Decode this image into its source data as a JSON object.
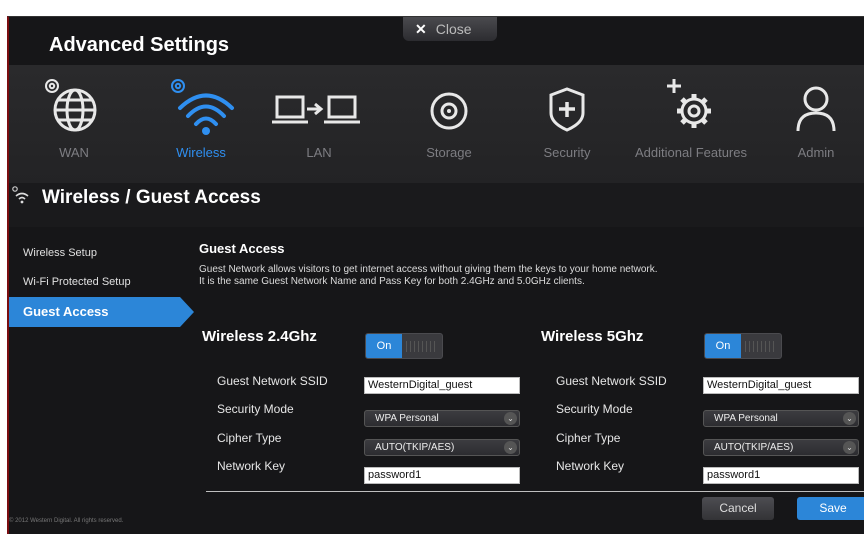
{
  "window": {
    "title": "Advanced Settings",
    "close_label": "Close"
  },
  "nav": {
    "items": [
      {
        "label": "WAN",
        "icon": "globe-gear-icon",
        "active": false
      },
      {
        "label": "Wireless",
        "icon": "wifi-gear-icon",
        "active": true
      },
      {
        "label": "LAN",
        "icon": "lan-computers-icon",
        "active": false
      },
      {
        "label": "Storage",
        "icon": "storage-disc-icon",
        "active": false
      },
      {
        "label": "Security",
        "icon": "shield-plus-icon",
        "active": false
      },
      {
        "label": "Additional Features",
        "icon": "gear-plus-icon",
        "active": false
      },
      {
        "label": "Admin",
        "icon": "user-icon",
        "active": false
      }
    ]
  },
  "section": {
    "title": "Wireless / Guest Access",
    "icon": "wifi-icon"
  },
  "sidebar": {
    "items": [
      {
        "label": "Wireless Setup",
        "active": false
      },
      {
        "label": "Wi-Fi Protected Setup",
        "active": false
      },
      {
        "label": "Guest Access",
        "active": true
      }
    ]
  },
  "guest_access": {
    "title": "Guest Access",
    "desc_line1": "Guest Network allows visitors to get internet access without giving them the keys to your home network.",
    "desc_line2": "It is the same Guest Network Name and Pass Key for both 2.4GHz and 5.0GHz clients."
  },
  "bands": [
    {
      "title": "Wireless 2.4Ghz",
      "toggle": "On",
      "ssid_label": "Guest Network SSID",
      "ssid_value": "WesternDigital_guest",
      "security_label": "Security Mode",
      "security_value": "WPA Personal",
      "cipher_label": "Cipher Type",
      "cipher_value": "AUTO(TKIP/AES)",
      "key_label": "Network Key",
      "key_value": "password1"
    },
    {
      "title": "Wireless 5Ghz",
      "toggle": "On",
      "ssid_label": "Guest Network SSID",
      "ssid_value": "WesternDigital_guest",
      "security_label": "Security Mode",
      "security_value": "WPA Personal",
      "cipher_label": "Cipher Type",
      "cipher_value": "AUTO(TKIP/AES)",
      "key_label": "Network Key",
      "key_value": "password1"
    }
  ],
  "actions": {
    "cancel": "Cancel",
    "save": "Save"
  },
  "footer": {
    "copyright": "© 2012 Western Digital. All rights reserved."
  },
  "colors": {
    "accent": "#2c86d8",
    "background": "#161618",
    "frame_border": "#7a0d10"
  }
}
